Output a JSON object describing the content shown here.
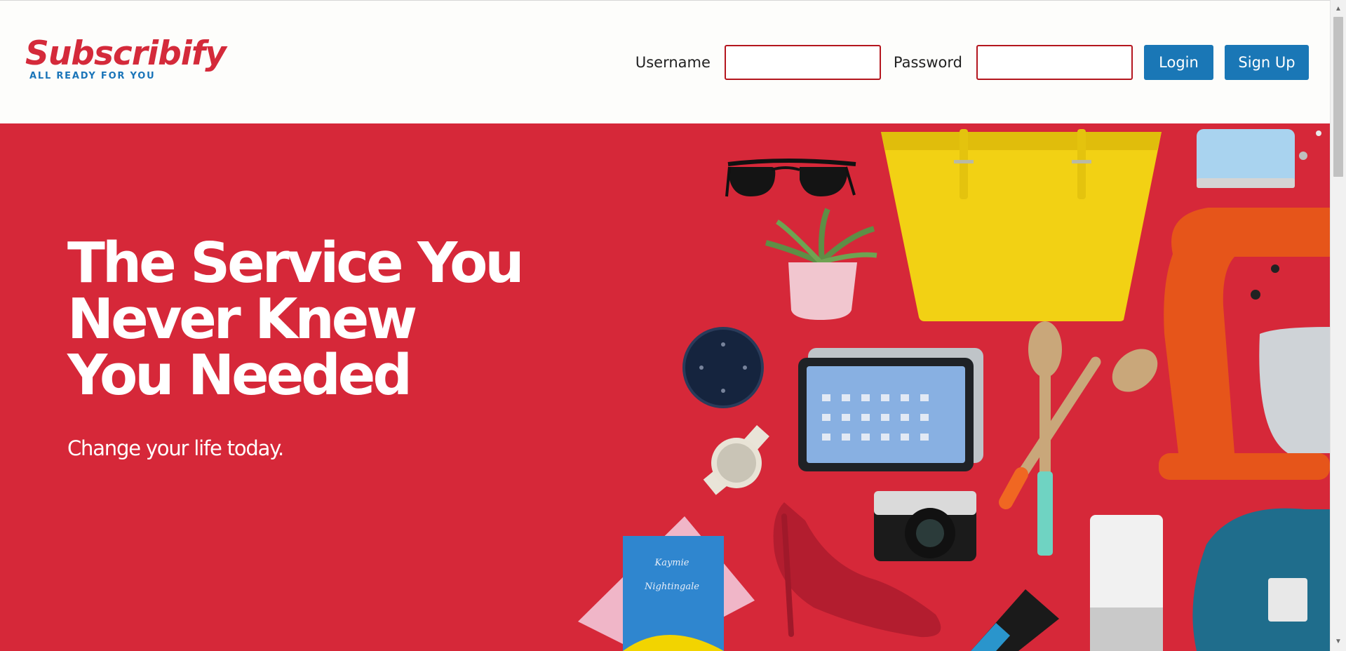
{
  "header": {
    "logo_name": "Subscribify",
    "logo_tagline": "ALL READY FOR YOU",
    "username_label": "Username",
    "username_value": "",
    "password_label": "Password",
    "password_value": "",
    "login_label": "Login",
    "signup_label": "Sign Up"
  },
  "hero": {
    "title_lines": [
      "The Service You",
      "Never Knew",
      "You Needed"
    ],
    "subtitle": "Change your life today.",
    "book_title_line1": "Kaymie",
    "book_title_line2": "Nightingale",
    "products": [
      "sunglasses",
      "yellow-tote-bag",
      "blue-toaster",
      "potted-succulent",
      "smart-speaker",
      "tablet",
      "wooden-spoon",
      "wooden-fork",
      "stand-mixer",
      "wristwatch",
      "camera",
      "book",
      "red-high-heel",
      "shaver",
      "white-speaker",
      "electric-guitar"
    ]
  },
  "colors": {
    "brand_red": "#d62839",
    "logo_red": "#d42a3a",
    "brand_blue": "#1a77b6",
    "input_border": "#b4161e",
    "header_bg": "#fdfdfb"
  },
  "scrollbar": {
    "up_icon": "triangle-up",
    "down_icon": "triangle-down"
  }
}
